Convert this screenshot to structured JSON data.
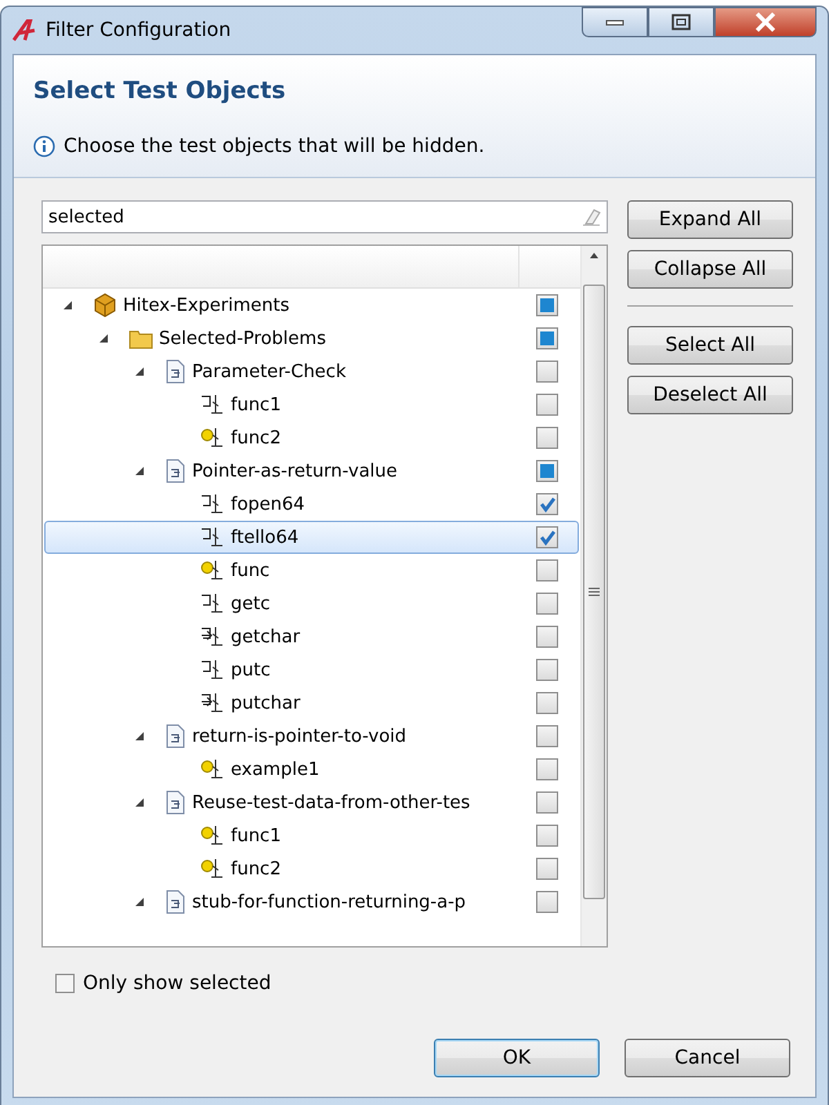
{
  "window": {
    "title": "Filter Configuration"
  },
  "header": {
    "title": "Select Test Objects",
    "message": "Choose the test objects that will be hidden."
  },
  "filter": {
    "value": "selected"
  },
  "tree": [
    {
      "label": "Hitex-Experiments",
      "kind": "project",
      "checked": false,
      "partial": true,
      "expanded": true,
      "selected": false,
      "children": [
        {
          "label": "Selected-Problems",
          "kind": "folder",
          "checked": false,
          "partial": true,
          "expanded": true,
          "selected": false,
          "children": [
            {
              "label": "Parameter-Check",
              "kind": "file",
              "checked": false,
              "partial": false,
              "expanded": true,
              "selected": false,
              "children": [
                {
                  "label": "func1",
                  "kind": "function",
                  "checked": false,
                  "partial": false,
                  "selected": false
                },
                {
                  "label": "func2",
                  "kind": "function-dot",
                  "checked": false,
                  "partial": false,
                  "selected": false
                }
              ]
            },
            {
              "label": "Pointer-as-return-value",
              "kind": "file",
              "checked": false,
              "partial": true,
              "expanded": true,
              "selected": false,
              "children": [
                {
                  "label": "fopen64",
                  "kind": "function",
                  "checked": true,
                  "partial": false,
                  "selected": false
                },
                {
                  "label": "ftello64",
                  "kind": "function",
                  "checked": true,
                  "partial": false,
                  "selected": true
                },
                {
                  "label": "func",
                  "kind": "function-dot",
                  "checked": false,
                  "partial": false,
                  "selected": false
                },
                {
                  "label": "getc",
                  "kind": "function",
                  "checked": false,
                  "partial": false,
                  "selected": false
                },
                {
                  "label": "getchar",
                  "kind": "function-arrow",
                  "checked": false,
                  "partial": false,
                  "selected": false
                },
                {
                  "label": "putc",
                  "kind": "function",
                  "checked": false,
                  "partial": false,
                  "selected": false
                },
                {
                  "label": "putchar",
                  "kind": "function-arrow",
                  "checked": false,
                  "partial": false,
                  "selected": false
                }
              ]
            },
            {
              "label": "return-is-pointer-to-void",
              "kind": "file",
              "checked": false,
              "partial": false,
              "expanded": true,
              "selected": false,
              "children": [
                {
                  "label": "example1",
                  "kind": "function-dot",
                  "checked": false,
                  "partial": false,
                  "selected": false
                }
              ]
            },
            {
              "label": "Reuse-test-data-from-other-tes",
              "kind": "file",
              "checked": false,
              "partial": false,
              "expanded": true,
              "selected": false,
              "children": [
                {
                  "label": "func1",
                  "kind": "function-dot",
                  "checked": false,
                  "partial": false,
                  "selected": false
                },
                {
                  "label": "func2",
                  "kind": "function-dot",
                  "checked": false,
                  "partial": false,
                  "selected": false
                }
              ]
            },
            {
              "label": "stub-for-function-returning-a-p",
              "kind": "file",
              "checked": false,
              "partial": false,
              "expanded": true,
              "selected": false
            }
          ]
        }
      ]
    }
  ],
  "side_buttons": [
    "Expand All",
    "Collapse All",
    "Select All",
    "Deselect All"
  ],
  "only_show_selected": {
    "label": "Only show selected",
    "checked": false
  },
  "buttons": [
    {
      "label": "OK",
      "default": true
    },
    {
      "label": "Cancel",
      "default": false
    }
  ]
}
